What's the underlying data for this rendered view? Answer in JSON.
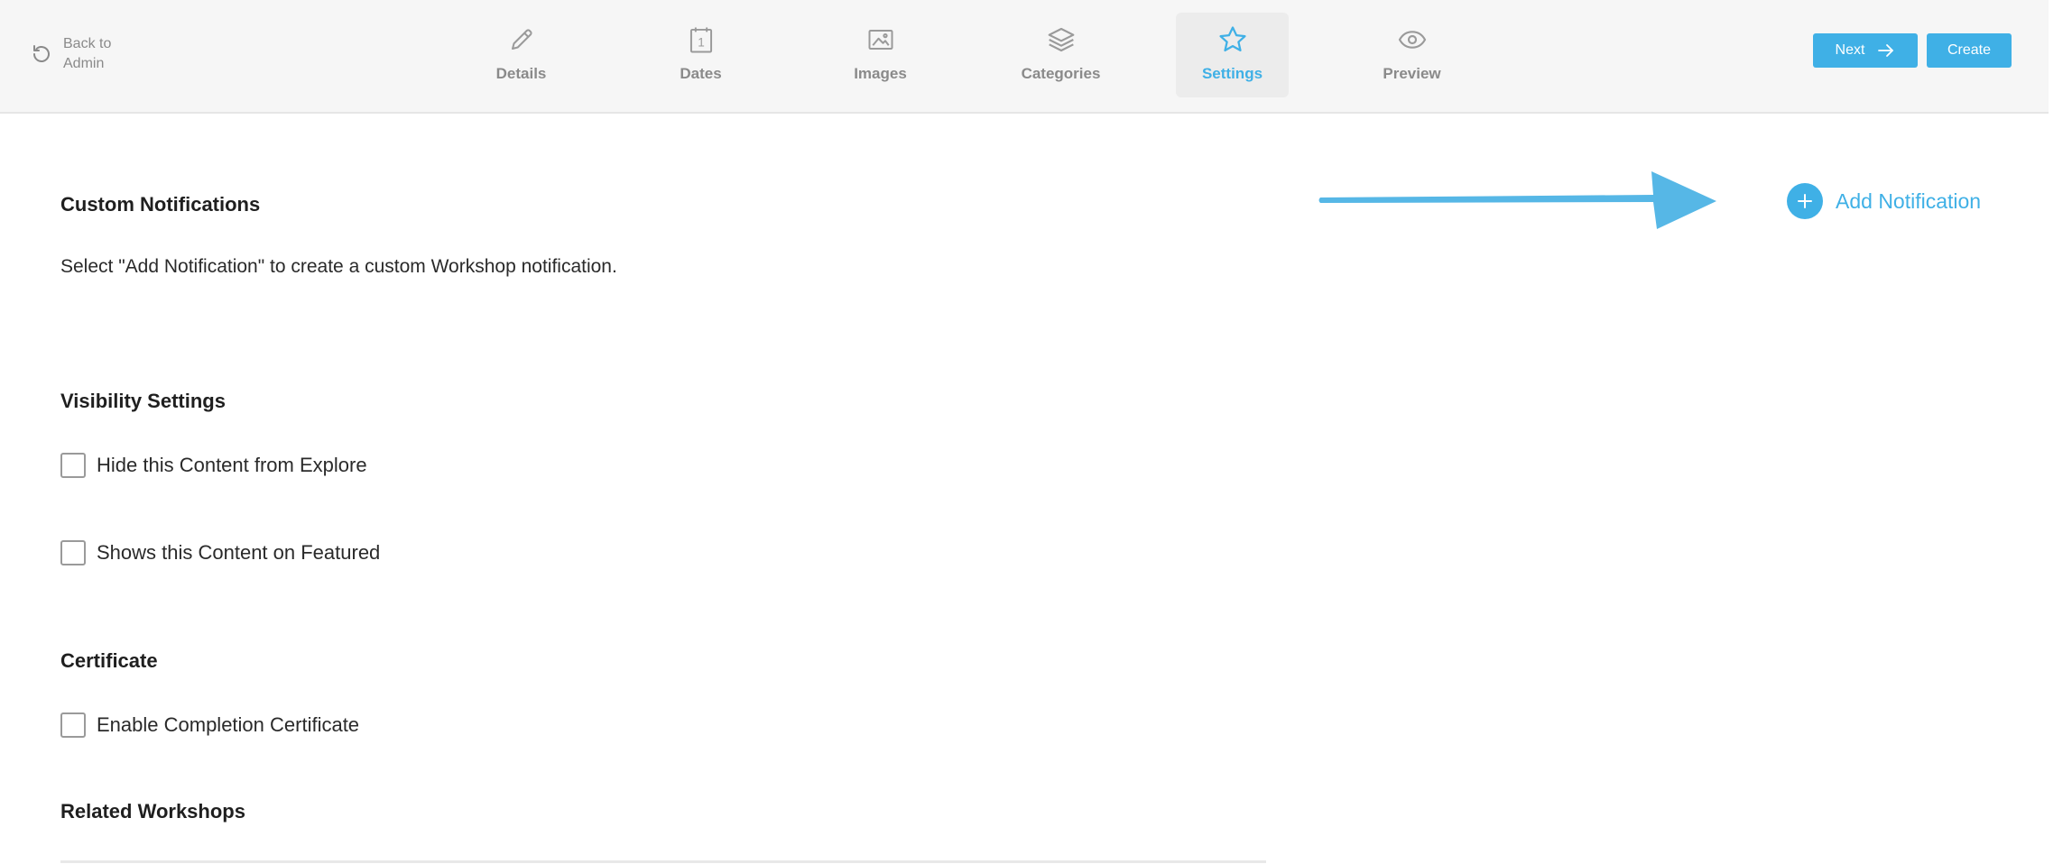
{
  "header": {
    "back_label": "Back to Admin",
    "tabs": [
      {
        "label": "Details",
        "icon": "pencil-icon"
      },
      {
        "label": "Dates",
        "icon": "calendar-icon"
      },
      {
        "label": "Images",
        "icon": "image-icon"
      },
      {
        "label": "Categories",
        "icon": "layers-icon"
      },
      {
        "label": "Settings",
        "icon": "star-icon",
        "active": true
      },
      {
        "label": "Preview",
        "icon": "eye-icon"
      }
    ],
    "next_label": "Next",
    "create_label": "Create"
  },
  "custom_notifications": {
    "title": "Custom Notifications",
    "description": "Select \"Add Notification\" to create a custom Workshop notification.",
    "add_label": "Add Notification"
  },
  "visibility": {
    "title": "Visibility Settings",
    "options": [
      {
        "label": "Hide this Content from Explore",
        "checked": false
      },
      {
        "label": "Shows this Content on Featured",
        "checked": false
      }
    ]
  },
  "certificate": {
    "title": "Certificate",
    "option": {
      "label": "Enable Completion Certificate",
      "checked": false
    }
  },
  "related": {
    "title": "Related Workshops"
  },
  "colors": {
    "accent": "#3fb0e6",
    "header_bg": "#f6f6f6",
    "muted_text": "#8a8a8a"
  }
}
